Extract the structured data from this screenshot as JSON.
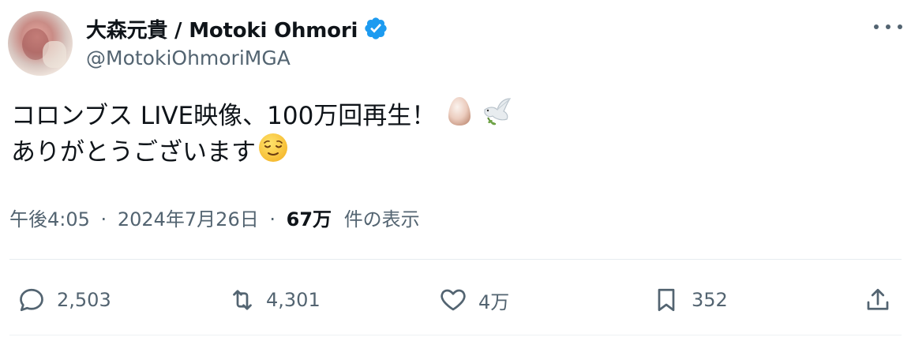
{
  "user": {
    "display_name": "大森元貴 / Motoki Ohmori",
    "handle": "@MotokiOhmoriMGA",
    "verified": true
  },
  "tweet": {
    "line1": "コロンブス LIVE映像、100万回再生！",
    "line1_emojis": [
      "egg-emoji",
      "dove-emoji"
    ],
    "line2": "ありがとうございます",
    "line2_emojis": [
      "relieved-face-emoji"
    ]
  },
  "meta": {
    "time": "午後4:05",
    "separator": "·",
    "date": "2024年7月26日",
    "views_count": "67万",
    "views_label": "件の表示"
  },
  "actions": {
    "reply_count": "2,503",
    "retweet_count": "4,301",
    "like_count": "4万",
    "bookmark_count": "352"
  },
  "colors": {
    "verified_blue": "#1d9bf0",
    "secondary_text": "#536471",
    "primary_text": "#0f1419"
  }
}
